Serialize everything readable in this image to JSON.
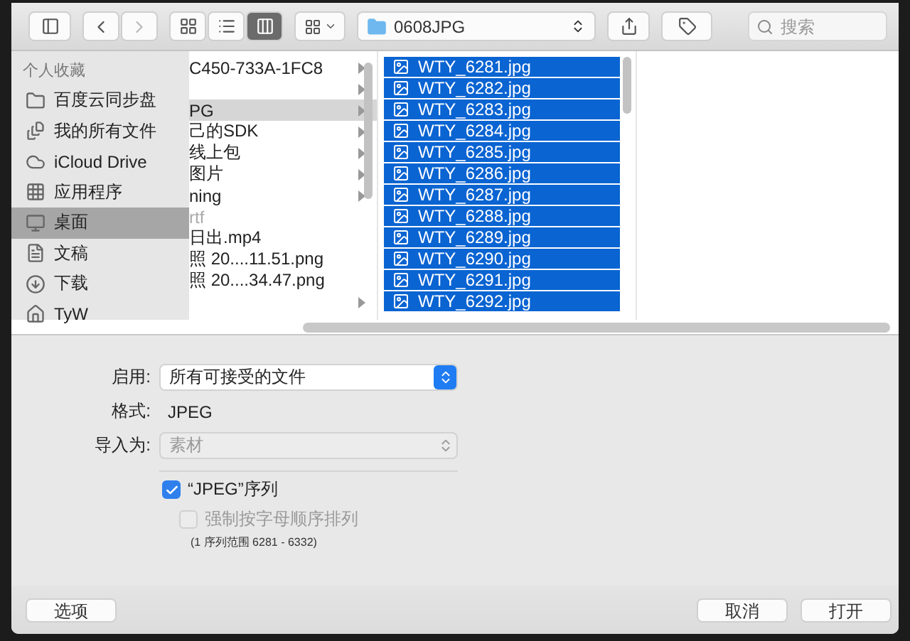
{
  "toolbar": {
    "back_disabled": false,
    "forward_disabled": true,
    "views": [
      {
        "kind": "icons",
        "selected": false
      },
      {
        "kind": "list",
        "selected": false
      },
      {
        "kind": "columns",
        "selected": true
      }
    ],
    "path": "0608JPG",
    "search": {
      "placeholder": "搜索"
    }
  },
  "sidebar": {
    "heading": "个人收藏",
    "items": [
      {
        "label": "百度云同步盘",
        "kind": "folder",
        "selected": false
      },
      {
        "label": "我的所有文件",
        "kind": "all-files",
        "selected": false
      },
      {
        "label": "iCloud Drive",
        "kind": "cloud",
        "selected": false
      },
      {
        "label": "应用程序",
        "kind": "apps",
        "selected": false
      },
      {
        "label": "桌面",
        "kind": "desktop",
        "selected": true
      },
      {
        "label": "文稿",
        "kind": "documents",
        "selected": false
      },
      {
        "label": "下载",
        "kind": "downloads",
        "selected": false
      },
      {
        "label": "TyW",
        "kind": "home",
        "selected": false
      }
    ]
  },
  "column_1": [
    {
      "label": "C450-733A-1FC8",
      "folder": true,
      "selected": false,
      "disabled": false
    },
    {
      "folder": true,
      "selected": false,
      "disabled": false
    },
    {
      "label": "PG",
      "folder": true,
      "selected": true,
      "disabled": false
    },
    {
      "label": "己的SDK",
      "folder": true,
      "selected": false,
      "disabled": false
    },
    {
      "label": "线上包",
      "folder": true,
      "selected": false,
      "disabled": false
    },
    {
      "label": "图片",
      "folder": true,
      "selected": false,
      "disabled": false
    },
    {
      "label": "ning",
      "folder": true,
      "selected": false,
      "disabled": false
    },
    {
      "label": "rtf",
      "folder": false,
      "selected": false,
      "disabled": true
    },
    {
      "label": "日出.mp4",
      "folder": false,
      "selected": false,
      "disabled": false
    },
    {
      "label": "照 20....11.51.png",
      "folder": false,
      "selected": false,
      "disabled": false
    },
    {
      "label": "照 20....34.47.png",
      "folder": false,
      "selected": false,
      "disabled": false
    },
    {
      "folder": true,
      "selected": false,
      "disabled": false
    }
  ],
  "column_2": [
    {
      "label": "WTY_6281.jpg",
      "selected": true
    },
    {
      "label": "WTY_6282.jpg",
      "selected": true
    },
    {
      "label": "WTY_6283.jpg",
      "selected": true
    },
    {
      "label": "WTY_6284.jpg",
      "selected": true
    },
    {
      "label": "WTY_6285.jpg",
      "selected": true
    },
    {
      "label": "WTY_6286.jpg",
      "selected": true
    },
    {
      "label": "WTY_6287.jpg",
      "selected": true
    },
    {
      "label": "WTY_6288.jpg",
      "selected": true
    },
    {
      "label": "WTY_6289.jpg",
      "selected": true
    },
    {
      "label": "WTY_6290.jpg",
      "selected": true
    },
    {
      "label": "WTY_6291.jpg",
      "selected": true
    },
    {
      "label": "WTY_6292.jpg",
      "selected": true
    }
  ],
  "options": {
    "enable": {
      "label": "启用:",
      "value": "所有可接受的文件",
      "disabled": false
    },
    "format": {
      "label": "格式:",
      "value": "JPEG"
    },
    "import_as": {
      "label": "导入为:",
      "value": "素材",
      "disabled": true
    },
    "sequence": {
      "label": "“JPEG”序列",
      "checked": true,
      "disabled": false
    },
    "alphabetical": {
      "label": "强制按字母顺序排列",
      "checked": false,
      "disabled": true
    },
    "note": "(1 序列范围 6281 - 6332)"
  },
  "buttons": {
    "options": "选项",
    "cancel": "取消",
    "open": "打开"
  }
}
